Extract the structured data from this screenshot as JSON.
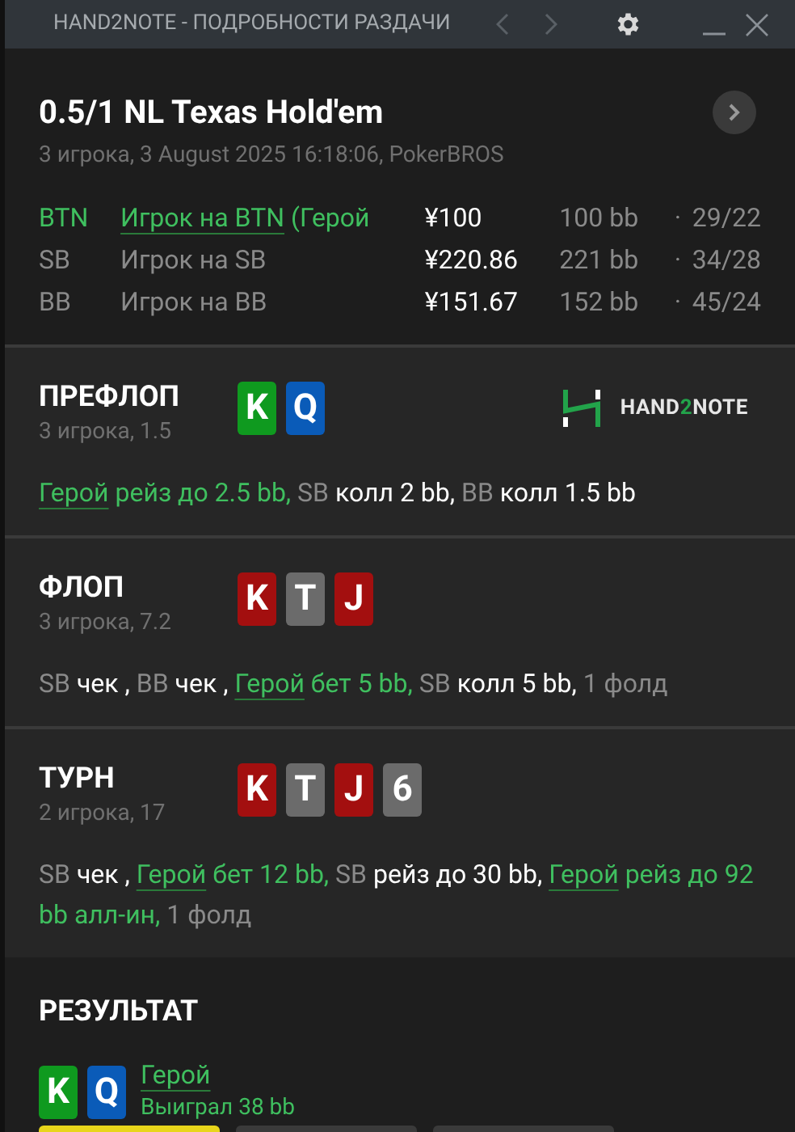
{
  "window": {
    "title": "HAND2NOTE - ПОДРОБНОСТИ РАЗДАЧИ",
    "nav_prev_disabled": true,
    "nav_next_disabled": true
  },
  "hand": {
    "title": "0.5/1 NL Texas Hold'em",
    "subtitle": "3 игрока, 3 August 2025 16:18:06, PokerBROS"
  },
  "players": [
    {
      "position": "BTN",
      "name": "Игрок на BTN",
      "suffix": "(Герой",
      "hero": true,
      "stack": "¥100",
      "bb": "100 bb",
      "sep": "·",
      "stats": "29/22"
    },
    {
      "position": "SB",
      "name": "Игрок на SB",
      "hero": false,
      "stack": "¥220.86",
      "bb": "221 bb",
      "sep": "·",
      "stats": "34/28"
    },
    {
      "position": "BB",
      "name": "Игрок на BB",
      "hero": false,
      "stack": "¥151.67",
      "bb": "152 bb",
      "sep": "·",
      "stats": "45/24"
    }
  ],
  "streets": [
    {
      "name": "ПРЕФЛОП",
      "info": "3 игрока, 1.5",
      "cards": [
        {
          "rank": "K",
          "color": "#0f9a1f"
        },
        {
          "rank": "Q",
          "color": "#0a5bb8"
        }
      ],
      "logo": {
        "text_a": "HAND",
        "text_b": "2",
        "text_c": "NOTE"
      },
      "actions": [
        {
          "actor": "Герой",
          "hero": true,
          "text": "рейз до 2.5 bb,"
        },
        {
          "actor": "SB",
          "hero": false,
          "text": "колл 2 bb,"
        },
        {
          "actor": "BB",
          "hero": false,
          "text": "колл 1.5 bb"
        }
      ]
    },
    {
      "name": "ФЛОП",
      "info": "3 игрока, 7.2",
      "cards": [
        {
          "rank": "K",
          "color": "#a30f0f"
        },
        {
          "rank": "T",
          "color": "#6b6b6b"
        },
        {
          "rank": "J",
          "color": "#a30f0f"
        }
      ],
      "actions": [
        {
          "actor": "SB",
          "hero": false,
          "text": "чек ,"
        },
        {
          "actor": "BB",
          "hero": false,
          "text": "чек ,"
        },
        {
          "actor": "Герой",
          "hero": true,
          "text": "бет 5 bb,"
        },
        {
          "actor": "SB",
          "hero": false,
          "text": "колл 5 bb,"
        }
      ],
      "folds": "1 фолд"
    },
    {
      "name": "ТУРН",
      "info": "2 игрока, 17",
      "cards": [
        {
          "rank": "K",
          "color": "#a30f0f"
        },
        {
          "rank": "T",
          "color": "#6b6b6b"
        },
        {
          "rank": "J",
          "color": "#a30f0f"
        },
        {
          "rank": "6",
          "color": "#6b6b6b"
        }
      ],
      "actions": [
        {
          "actor": "SB",
          "hero": false,
          "text": "чек ,"
        },
        {
          "actor": "Герой",
          "hero": true,
          "text": "бет 12 bb,"
        },
        {
          "actor": "SB",
          "hero": false,
          "text": "рейз до 30 bb,"
        },
        {
          "actor": "Герой",
          "hero": true,
          "text": "рейз до 92 bb алл-ин,"
        }
      ],
      "folds": "1 фолд"
    }
  ],
  "result": {
    "title": "РЕЗУЛЬТАТ",
    "winners": [
      {
        "cards": [
          {
            "rank": "K",
            "color": "#0f9a1f"
          },
          {
            "rank": "Q",
            "color": "#0a5bb8"
          }
        ],
        "name": "Герой",
        "outcome": "Выиграл 38 bb"
      }
    ]
  },
  "bottom_buttons": [
    {
      "primary": true
    },
    {
      "primary": false
    },
    {
      "primary": false
    }
  ]
}
